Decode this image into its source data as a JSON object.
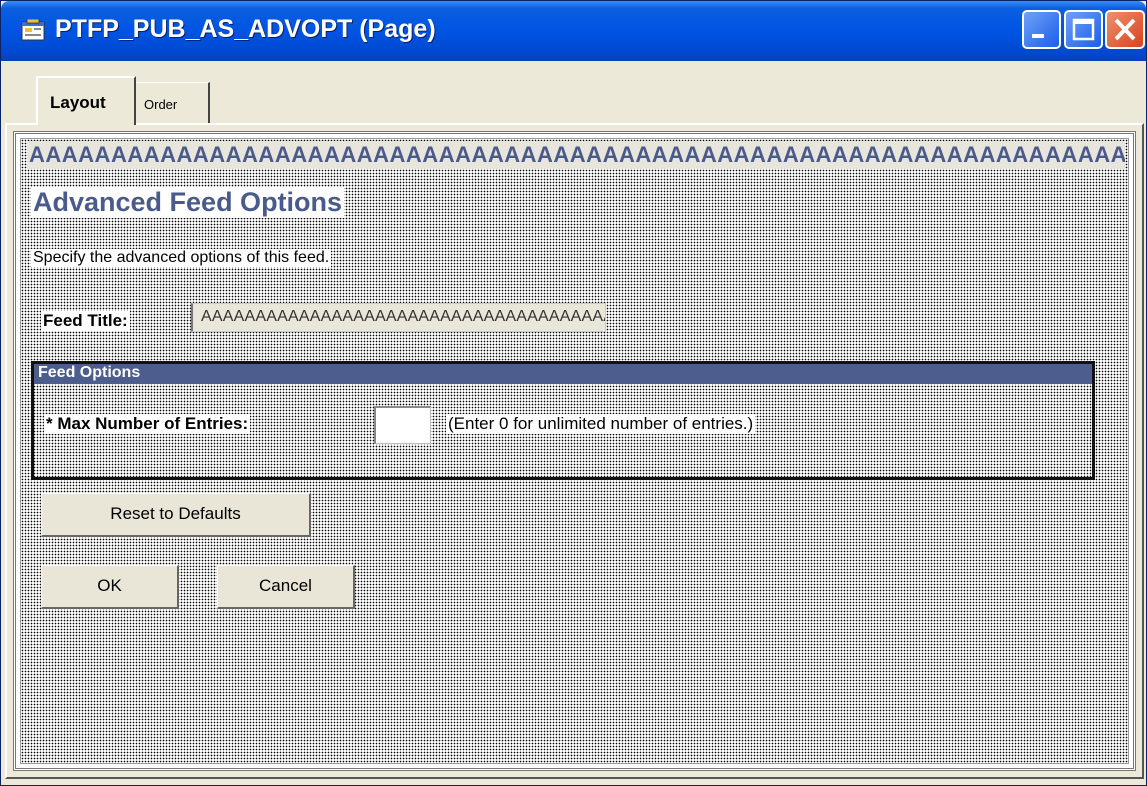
{
  "window": {
    "title": "PTFP_PUB_AS_ADVOPT (Page)",
    "icon": "page-definition-icon",
    "controls": [
      "minimize-icon",
      "maximize-icon",
      "close-icon"
    ]
  },
  "tabs": [
    {
      "label": "Layout",
      "active": true
    },
    {
      "label": "Order",
      "active": false
    }
  ],
  "page": {
    "banner_text": "AAAAAAAAAAAAAAAAAAAAAAAAAAAAAAAAAAAAAAAAAAAAAAAAAAAAAAAAAAAAAAAAAAAAAAA",
    "heading": "Advanced Feed Options",
    "description": "Specify the advanced options of this feed.",
    "feed_title_label": "Feed Title:",
    "feed_title_value": "AAAAAAAAAAAAAAAAAAAAAAAAAAAAAAAAAAAAAA",
    "group": {
      "header": "Feed Options",
      "max_entries_label": "* Max Number of Entries:",
      "max_entries_value": "",
      "hint": "(Enter 0 for unlimited number of entries.)"
    },
    "buttons": {
      "reset": "Reset to Defaults",
      "ok": "OK",
      "cancel": "Cancel"
    }
  },
  "colors": {
    "titlebar": "#0054e3",
    "heading": "#4a5b8b",
    "group_header": "#4c5d8e"
  }
}
